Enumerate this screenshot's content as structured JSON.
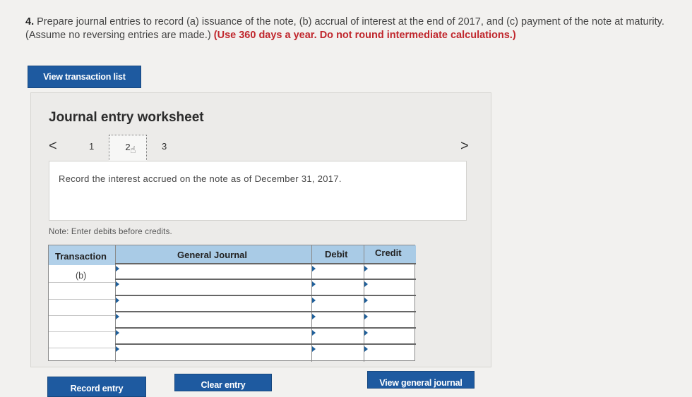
{
  "question": {
    "number": "4.",
    "text": "Prepare journal entries to record (a) issuance of the note, (b) accrual of interest at the end of 2017, and (c) payment of the note at maturity. (Assume no reversing entries are made.)",
    "emphasis": "(Use 360 days a year. Do not round intermediate calculations.)"
  },
  "buttons": {
    "view_transactions": "View transaction list",
    "record_entry": "Record entry",
    "clear_entry": "Clear entry",
    "view_general_journal": "View general journal"
  },
  "worksheet": {
    "title": "Journal entry worksheet",
    "pages": [
      "1",
      "2",
      "3"
    ],
    "current_page": "2",
    "prev_glyph": "<",
    "next_glyph": ">",
    "prompt": "Record the interest accrued on the note as of December 31, 2017.",
    "note": "Note: Enter debits before credits."
  },
  "journal_table": {
    "columns": [
      "Transaction",
      "General Journal",
      "Debit",
      "Credit"
    ],
    "rows": [
      {
        "transaction": "(b)",
        "account": "",
        "debit": "",
        "credit": ""
      },
      {
        "transaction": "",
        "account": "",
        "debit": "",
        "credit": ""
      },
      {
        "transaction": "",
        "account": "",
        "debit": "",
        "credit": ""
      },
      {
        "transaction": "",
        "account": "",
        "debit": "",
        "credit": ""
      },
      {
        "transaction": "",
        "account": "",
        "debit": "",
        "credit": ""
      },
      {
        "transaction": "",
        "account": "",
        "debit": "",
        "credit": ""
      }
    ]
  },
  "colors": {
    "accent": "#1e5aa0",
    "emphasis": "#c0272d",
    "table_header": "#a9cbe6"
  },
  "icons": {
    "pointer": "hand-pointer-icon"
  }
}
